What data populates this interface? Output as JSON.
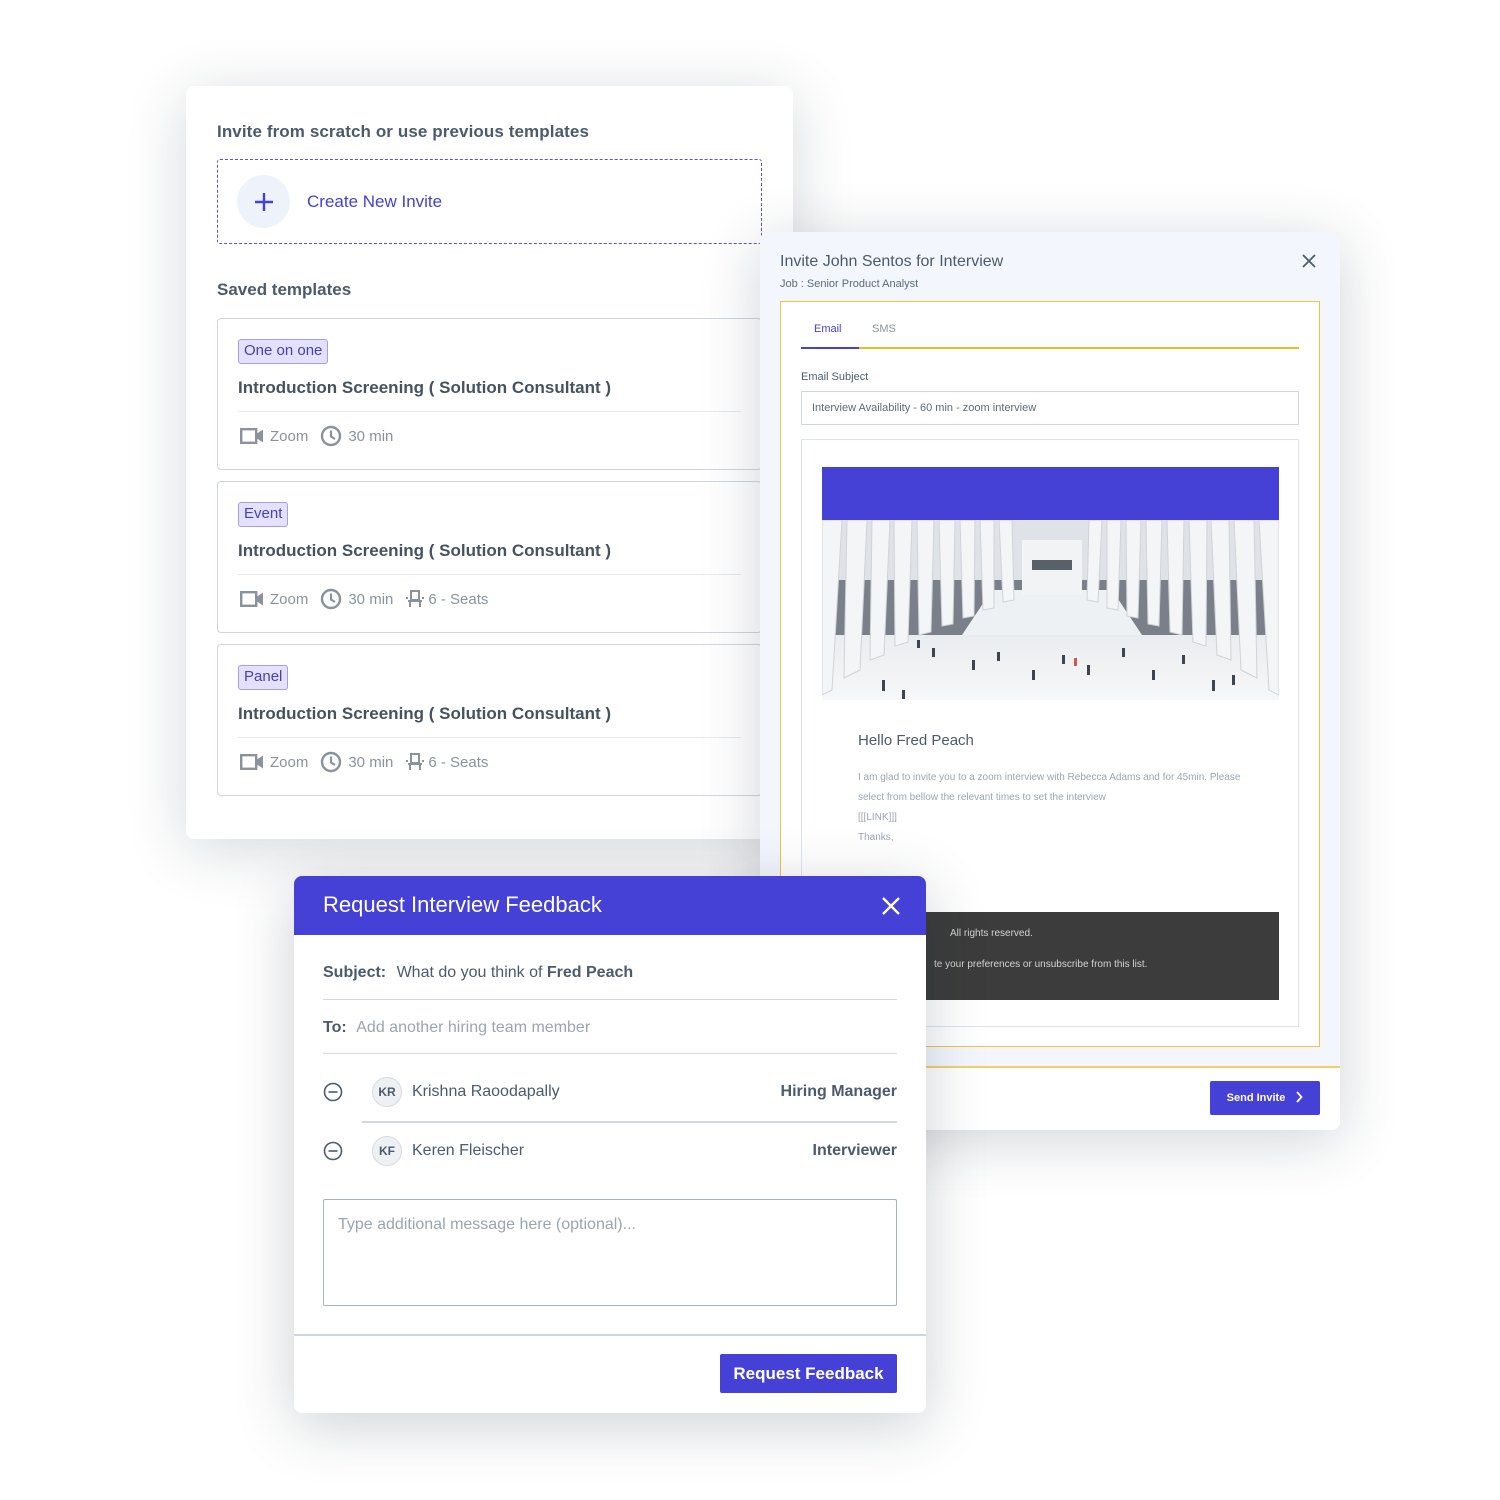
{
  "templates_panel": {
    "heading": "Invite from scratch or use previous templates",
    "create_label": "Create New Invite",
    "saved_heading": "Saved templates",
    "templates": [
      {
        "tag": "One on one",
        "title": "Introduction Screening ( Solution Consultant )",
        "platform": "Zoom",
        "duration": "30 min",
        "seats": null
      },
      {
        "tag": "Event",
        "title": "Introduction Screening ( Solution Consultant )",
        "platform": "Zoom",
        "duration": "30 min",
        "seats": "6 - Seats"
      },
      {
        "tag": "Panel",
        "title": "Introduction Screening ( Solution Consultant )",
        "platform": "Zoom",
        "duration": "30 min",
        "seats": "6 - Seats"
      }
    ]
  },
  "invite_modal": {
    "title": "Invite John Sentos for Interview",
    "subtitle": "Job : Senior Product Analyst",
    "tabs": [
      {
        "label": "Email",
        "active": true
      },
      {
        "label": "SMS",
        "active": false
      }
    ],
    "subject_label": "Email Subject",
    "subject_value": "Interview Availability - 60 min - zoom interview",
    "preview": {
      "greeting": "Hello Fred Peach",
      "body_line1": "I am glad to invite you to a zoom interview with Rebecca Adams and for 45min. Please select from bellow the relevant times to set the interview",
      "body_link": "[[[LINK]]]",
      "body_thanks": "Thanks,",
      "footer_line1": "All rights reserved.",
      "footer_line2": "te your preferences or unsubscribe from this list."
    },
    "send_label": "Send Invite"
  },
  "feedback_modal": {
    "title": "Request Interview Feedback",
    "subject_label": "Subject:",
    "subject_prefix": "What do you think of ",
    "subject_name": "Fred Peach",
    "to_label": "To:",
    "to_placeholder": "Add another hiring team member",
    "recipients": [
      {
        "initials": "KR",
        "name": "Krishna Raoodapally",
        "role": "Hiring Manager"
      },
      {
        "initials": "KF",
        "name": "Keren Fleischer",
        "role": "Interviewer"
      }
    ],
    "message_placeholder": "Type additional message here (optional)...",
    "submit_label": "Request Feedback"
  },
  "colors": {
    "brand": "#4541d6",
    "accent_yellow": "#f0b922",
    "tag_bg": "#e4e0ff",
    "text": "#4b5b6d"
  }
}
